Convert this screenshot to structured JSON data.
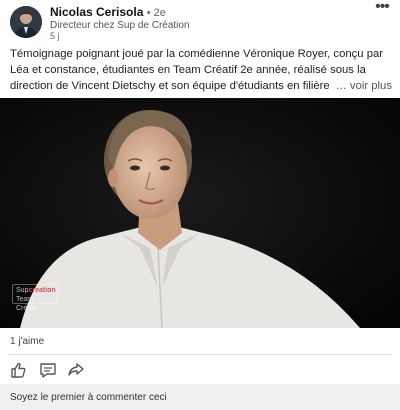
{
  "author": {
    "name": "Nicolas Cerisola",
    "degree": "• 2e",
    "headline": "Directeur chez Sup de Création",
    "time": "5 j",
    "avatar_icon": "person-avatar-icon"
  },
  "menu": {
    "more_label": "•••"
  },
  "post": {
    "text": "Témoignage poignant joué par la comédienne Véronique Royer, conçu par Léa et constance, étudiantes en Team Créatif 2e année, réalisé sous la direction de Vincent Dietschy et son équipe d'étudiants en filière Filmmaker. J'adi",
    "see_more": "… voir plus"
  },
  "video": {
    "watermark_line1": "Sup",
    "watermark_line1_accent": "creation",
    "watermark_line2": "Team Créatif"
  },
  "social": {
    "likes": "1 j'aime",
    "like_icon": "thumbs-up-icon",
    "comment_icon": "comment-icon",
    "share_icon": "share-icon"
  },
  "comment_prompt": "Soyez le premier à commenter ceci",
  "colors": {
    "accent": "#d9534f",
    "background": "#ffffff",
    "comment_bar": "#f0f0f0"
  }
}
